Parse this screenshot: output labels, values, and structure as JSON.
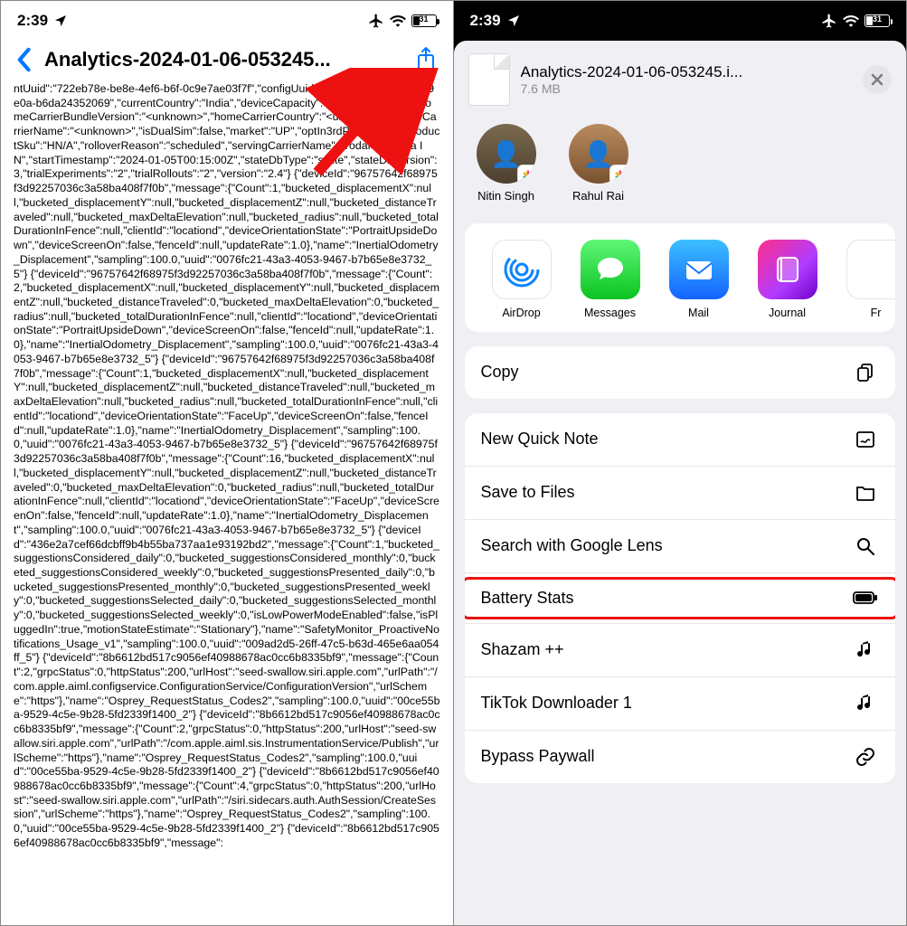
{
  "status": {
    "time": "2:39",
    "battery_pct": "31",
    "battery_fill_pct": 31
  },
  "left": {
    "title": "Analytics-2024-01-06-053245...",
    "body": "ntUuid\":\"722eb78e-be8e-4ef6-b6f-0c9e7ae03f7f\",\"configUuid\":\"0edf4fc7-08bb-453e-9e0a-b6da24352069\",\"currentCountry\":\"India\",\"deviceCapacity\":64,\"dramSize\":3.5,\"homeCarrierBundleVersion\":\"<unknown>\",\"homeCarrierCountry\":\"<unknown>\",\"homeCarrierName\":\"<unknown>\",\"isDualSim\":false,\"market\":\"UP\",\"optIn3rdParty\":false,\"productSku\":\"HN/A\",\"rolloverReason\":\"scheduled\",\"servingCarrierName\":\"Vodafone India IN\",\"startTimestamp\":\"2024-01-05T00:15:00Z\",\"stateDbType\":\"sqlite\",\"stateDbVersion\":3,\"trialExperiments\":\"2\",\"trialRollouts\":\"2\",\"version\":\"2.4\"}\n{\"deviceId\":\"96757642f68975f3d92257036c3a58ba408f7f0b\",\"message\":{\"Count\":1,\"bucketed_displacementX\":null,\"bucketed_displacementY\":null,\"bucketed_displacementZ\":null,\"bucketed_distanceTraveled\":null,\"bucketed_maxDeltaElevation\":null,\"bucketed_radius\":null,\"bucketed_totalDurationInFence\":null,\"clientId\":\"locationd\",\"deviceOrientationState\":\"PortraitUpsideDown\",\"deviceScreenOn\":false,\"fenceId\":null,\"updateRate\":1.0},\"name\":\"InertialOdometry_Displacement\",\"sampling\":100.0,\"uuid\":\"0076fc21-43a3-4053-9467-b7b65e8e3732_5\"}\n{\"deviceId\":\"96757642f68975f3d92257036c3a58ba408f7f0b\",\"message\":{\"Count\":2,\"bucketed_displacementX\":null,\"bucketed_displacementY\":null,\"bucketed_displacementZ\":null,\"bucketed_distanceTraveled\":0,\"bucketed_maxDeltaElevation\":0,\"bucketed_radius\":null,\"bucketed_totalDurationInFence\":null,\"clientId\":\"locationd\",\"deviceOrientationState\":\"PortraitUpsideDown\",\"deviceScreenOn\":false,\"fenceId\":null,\"updateRate\":1.0},\"name\":\"InertialOdometry_Displacement\",\"sampling\":100.0,\"uuid\":\"0076fc21-43a3-4053-9467-b7b65e8e3732_5\"}\n{\"deviceId\":\"96757642f68975f3d92257036c3a58ba408f7f0b\",\"message\":{\"Count\":1,\"bucketed_displacementX\":null,\"bucketed_displacementY\":null,\"bucketed_displacementZ\":null,\"bucketed_distanceTraveled\":null,\"bucketed_maxDeltaElevation\":null,\"bucketed_radius\":null,\"bucketed_totalDurationInFence\":null,\"clientId\":\"locationd\",\"deviceOrientationState\":\"FaceUp\",\"deviceScreenOn\":false,\"fenceId\":null,\"updateRate\":1.0},\"name\":\"InertialOdometry_Displacement\",\"sampling\":100.0,\"uuid\":\"0076fc21-43a3-4053-9467-b7b65e8e3732_5\"}\n{\"deviceId\":\"96757642f68975f3d92257036c3a58ba408f7f0b\",\"message\":{\"Count\":16,\"bucketed_displacementX\":null,\"bucketed_displacementY\":null,\"bucketed_displacementZ\":null,\"bucketed_distanceTraveled\":0,\"bucketed_maxDeltaElevation\":0,\"bucketed_radius\":null,\"bucketed_totalDurationInFence\":null,\"clientId\":\"locationd\",\"deviceOrientationState\":\"FaceUp\",\"deviceScreenOn\":false,\"fenceId\":null,\"updateRate\":1.0},\"name\":\"InertialOdometry_Displacement\",\"sampling\":100.0,\"uuid\":\"0076fc21-43a3-4053-9467-b7b65e8e3732_5\"}\n{\"deviceId\":\"436e2a7cef66dcbff9b4b55ba737aa1e93192bd2\",\"message\":{\"Count\":1,\"bucketed_suggestionsConsidered_daily\":0,\"bucketed_suggestionsConsidered_monthly\":0,\"bucketed_suggestionsConsidered_weekly\":0,\"bucketed_suggestionsPresented_daily\":0,\"bucketed_suggestionsPresented_monthly\":0,\"bucketed_suggestionsPresented_weekly\":0,\"bucketed_suggestionsSelected_daily\":0,\"bucketed_suggestionsSelected_monthly\":0,\"bucketed_suggestionsSelected_weekly\":0,\"isLowPowerModeEnabled\":false,\"isPluggedIn\":true,\"motionStateEstimate\":\"Stationary\"},\"name\":\"SafetyMonitor_ProactiveNotifications_Usage_v1\",\"sampling\":100.0,\"uuid\":\"009ad2d5-26ff-47c5-b63d-465e6aa054ff_5\"}\n{\"deviceId\":\"8b6612bd517c9056ef40988678ac0cc6b8335bf9\",\"message\":{\"Count\":2,\"grpcStatus\":0,\"httpStatus\":200,\"urlHost\":\"seed-swallow.siri.apple.com\",\"urlPath\":\"/com.apple.aiml.configservice.ConfigurationService/ConfigurationVersion\",\"urlScheme\":\"https\"},\"name\":\"Osprey_RequestStatus_Codes2\",\"sampling\":100.0,\"uuid\":\"00ce55ba-9529-4c5e-9b28-5fd2339f1400_2\"}\n{\"deviceId\":\"8b6612bd517c9056ef40988678ac0cc6b8335bf9\",\"message\":{\"Count\":2,\"grpcStatus\":0,\"httpStatus\":200,\"urlHost\":\"seed-swallow.siri.apple.com\",\"urlPath\":\"/com.apple.aiml.sis.InstrumentationService/Publish\",\"urlScheme\":\"https\"},\"name\":\"Osprey_RequestStatus_Codes2\",\"sampling\":100.0,\"uuid\":\"00ce55ba-9529-4c5e-9b28-5fd2339f1400_2\"}\n{\"deviceId\":\"8b6612bd517c9056ef40988678ac0cc6b8335bf9\",\"message\":{\"Count\":4,\"grpcStatus\":0,\"httpStatus\":200,\"urlHost\":\"seed-swallow.siri.apple.com\",\"urlPath\":\"/siri.sidecars.auth.AuthSession/CreateSession\",\"urlScheme\":\"https\"},\"name\":\"Osprey_RequestStatus_Codes2\",\"sampling\":100.0,\"uuid\":\"00ce55ba-9529-4c5e-9b28-5fd2339f1400_2\"}\n{\"deviceId\":\"8b6612bd517c9056ef40988678ac0cc6b8335bf9\",\"message\":"
  },
  "right": {
    "doc_title": "Analytics-2024-01-06-053245.i...",
    "doc_size": "7.6 MB",
    "contacts": [
      {
        "name": "Nitin Singh"
      },
      {
        "name": "Rahul Rai"
      }
    ],
    "apps": [
      {
        "label": "AirDrop"
      },
      {
        "label": "Messages"
      },
      {
        "label": "Mail"
      },
      {
        "label": "Journal"
      },
      {
        "label": "Fr"
      }
    ],
    "primary_action": "Copy",
    "secondary_actions": [
      "New Quick Note",
      "Save to Files",
      "Search with Google Lens",
      "Battery Stats",
      "Shazam ++",
      "TikTok Downloader 1",
      "Bypass Paywall"
    ]
  }
}
